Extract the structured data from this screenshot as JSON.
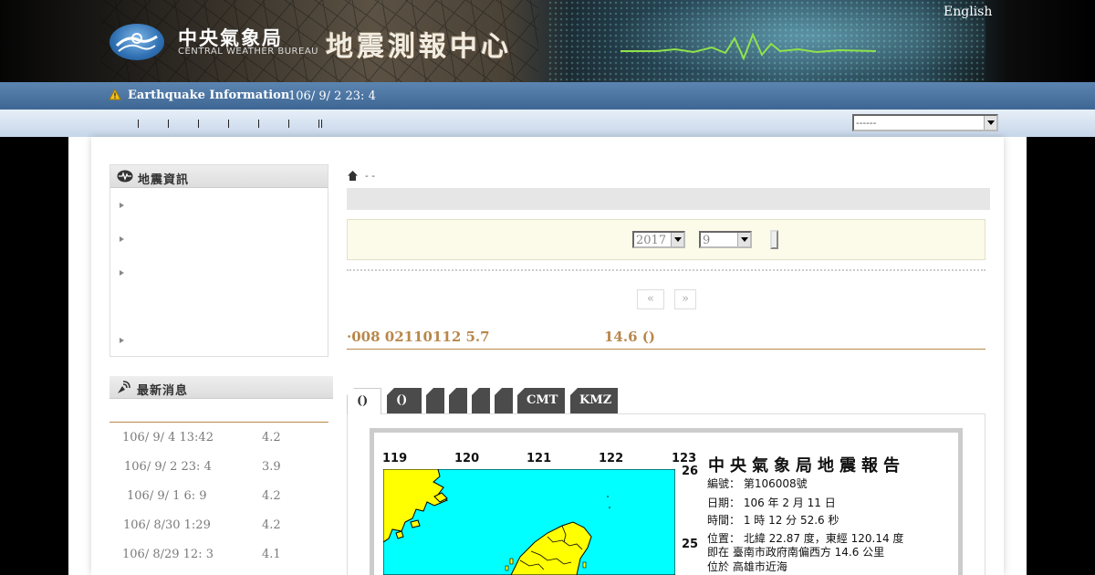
{
  "header": {
    "cwb_zh": "中央氣象局",
    "cwb_en": "CENTRAL WEATHER BUREAU",
    "center_title": "地震測報中心",
    "english_link": "English"
  },
  "info_bar": {
    "label": "Earthquake Information",
    "time": "106/ 9/ 2 23: 4",
    "icon": "warning-icon"
  },
  "nav": {
    "select_value": "------"
  },
  "sidebar": {
    "box1_title": "地震資訊",
    "box2_title": "最新消息",
    "recent_quakes": [
      {
        "time": "106/ 9/ 4 13:42",
        "mag": "4.2"
      },
      {
        "time": "106/ 9/ 2 23: 4",
        "mag": "3.9"
      },
      {
        "time": "106/ 9/ 1 6: 9",
        "mag": "4.2"
      },
      {
        "time": "106/ 8/30 1:29",
        "mag": "4.2"
      },
      {
        "time": "106/ 8/29 12: 3",
        "mag": "4.1"
      }
    ]
  },
  "breadcrumb": {
    "sep": "-  -"
  },
  "filter": {
    "year": "2017",
    "month": "9"
  },
  "pager": {
    "prev": "«",
    "next": "»"
  },
  "event": {
    "title_left": "·008 02110112 5.7",
    "title_right": "14.6  ()"
  },
  "tabs": [
    "()",
    "()",
    "",
    "",
    "",
    "",
    "CMT",
    "KMZ"
  ],
  "report": {
    "heading": "中央氣象局地震報告",
    "lons": [
      "119",
      "120",
      "121",
      "122",
      "123"
    ],
    "lats": [
      "26",
      "25"
    ],
    "lines": [
      "編號： 第106008號",
      "日期： 106 年 2 月 11 日",
      "時間： 1 時 12 分 52.6 秒",
      "位置： 北緯 22.87 度，東經 120.14 度",
      "即在 臺南市政府南偏西方 14.6 公里",
      "位於 高雄市近海"
    ]
  },
  "colors": {
    "info_bar": "#4a72a0",
    "accent_brown": "#b8874b",
    "sea": "#00ffff",
    "land": "#ffff00"
  }
}
